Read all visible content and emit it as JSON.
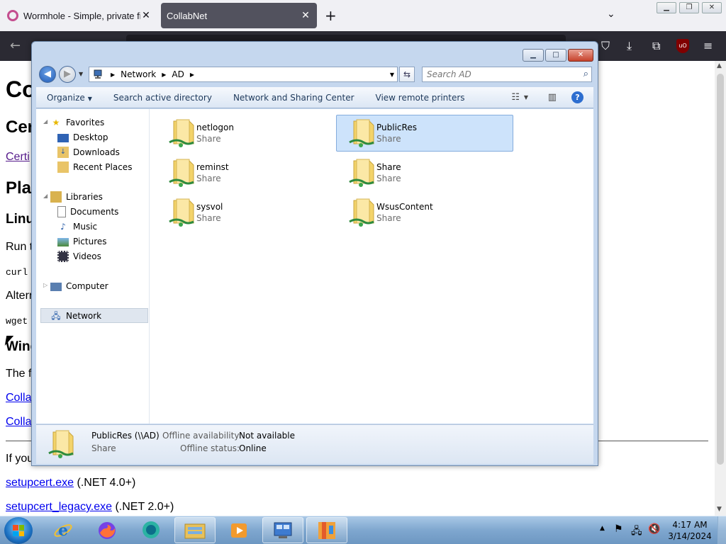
{
  "browser": {
    "tabs": [
      {
        "title": "Wormhole - Simple, private file"
      },
      {
        "title": "CollabNet"
      }
    ],
    "new_tab_icon": "plus-icon",
    "close_glyph": "✕"
  },
  "page": {
    "h1": "Co",
    "h2": "Cer",
    "cert_link": "Certi",
    "h2b": "Pla",
    "h3_linux": "Linu",
    "run_text": "Run t",
    "curl": "curl",
    "alt_text": "Alterr",
    "wget": "wget",
    "h3_windows": "Wind",
    "windows_text": "The f",
    "link1": "Colla",
    "link2": "Colla",
    "if_text": "If you",
    "setupcert_link": "setupcert.exe",
    "setupcert_note": " (.NET 4.0+)",
    "setupcert_legacy_link": "setupcert_legacy.exe",
    "setupcert_legacy_note": " (.NET 2.0+)"
  },
  "explorer": {
    "breadcrumb": [
      "Network",
      "AD"
    ],
    "search_placeholder": "Search AD",
    "toolbar": {
      "organize": "Organize",
      "search_ad": "Search active directory",
      "network_sharing": "Network and Sharing Center",
      "remote_printers": "View remote printers"
    },
    "nav": {
      "favorites": "Favorites",
      "desktop": "Desktop",
      "downloads": "Downloads",
      "recent": "Recent Places",
      "libraries": "Libraries",
      "documents": "Documents",
      "music": "Music",
      "pictures": "Pictures",
      "videos": "Videos",
      "computer": "Computer",
      "network": "Network"
    },
    "items": [
      {
        "name": "netlogon",
        "type": "Share"
      },
      {
        "name": "PublicRes",
        "type": "Share"
      },
      {
        "name": "reminst",
        "type": "Share"
      },
      {
        "name": "Share",
        "type": "Share"
      },
      {
        "name": "sysvol",
        "type": "Share"
      },
      {
        "name": "WsusContent",
        "type": "Share"
      }
    ],
    "details": {
      "name": "PublicRes (\\\\AD)",
      "type": "Share",
      "offline_availability_label": "Offline availability:",
      "offline_availability_value": "Not available",
      "offline_status_label": "Offline status:",
      "offline_status_value": "Online"
    }
  },
  "taskbar": {
    "time": "4:17 AM",
    "date": "3/14/2024"
  },
  "colors": {
    "selection": "#cde3fb",
    "folder": "#f3d36a",
    "link": "#0000ee",
    "visited": "#551a8b"
  }
}
